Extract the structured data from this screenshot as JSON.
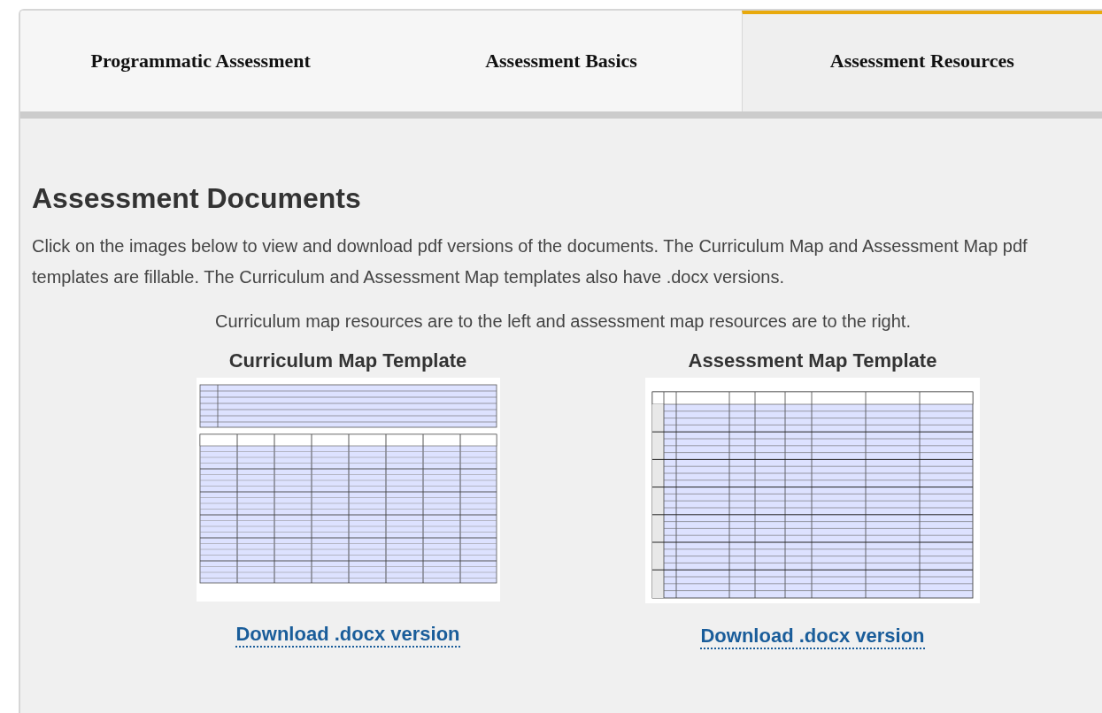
{
  "tabs": [
    {
      "label": "Programmatic Assessment",
      "selected": false
    },
    {
      "label": "Assessment Basics",
      "selected": false
    },
    {
      "label": "Assessment Resources",
      "selected": true
    }
  ],
  "heading": "Assessment Documents",
  "intro": "Click on the images below to view and download pdf versions of the documents. The Curriculum Map and Assessment Map pdf templates are fillable. The Curriculum and Assessment Map templates also have .docx versions.",
  "note": "Curriculum map resources are to the left and assessment map resources are to the right.",
  "resources": [
    {
      "title": "Curriculum Map Template",
      "kind": "curriculum",
      "link": "Download .docx version"
    },
    {
      "title": "Assessment Map Template",
      "kind": "assessment",
      "link": "Download .docx version"
    }
  ]
}
